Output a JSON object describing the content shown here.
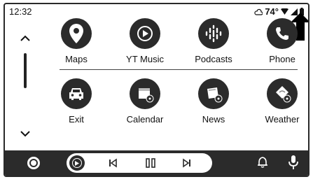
{
  "status_bar": {
    "time": "12:32",
    "temperature": "74°",
    "icons": [
      "weather-cloud-icon",
      "wifi-icon",
      "cell-signal-icon",
      "battery-icon",
      "up-arrow-indicator"
    ]
  },
  "sidebar": {
    "up": "chevron-up-icon",
    "down": "chevron-down-icon"
  },
  "apps": [
    {
      "label": "Maps",
      "icon": "map-pin-icon"
    },
    {
      "label": "YT Music",
      "icon": "yt-music-icon"
    },
    {
      "label": "Podcasts",
      "icon": "podcasts-icon"
    },
    {
      "label": "Phone",
      "icon": "phone-icon"
    },
    {
      "label": "Exit",
      "icon": "car-icon"
    },
    {
      "label": "Calendar",
      "icon": "calendar-icon"
    },
    {
      "label": "News",
      "icon": "news-icon"
    },
    {
      "label": "Weather",
      "icon": "weather-icon"
    }
  ],
  "nav_bar": {
    "home": "home-icon",
    "media_app": "yt-music-icon",
    "controls": [
      "skip-previous-icon",
      "pause-icon",
      "skip-next-icon"
    ],
    "notifications": "bell-icon",
    "voice": "microphone-icon"
  },
  "colors": {
    "accent": "#2b2b2b",
    "background": "#ffffff"
  }
}
